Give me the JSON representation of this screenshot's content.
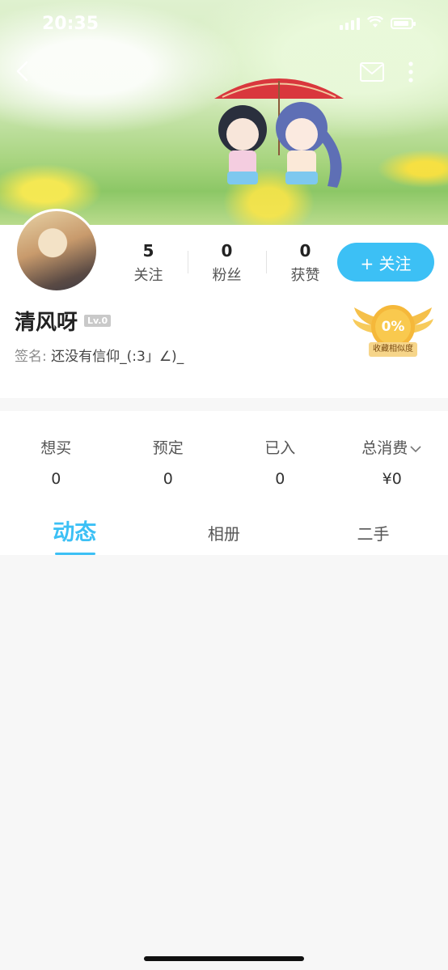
{
  "status_bar": {
    "time": "20:35"
  },
  "profile": {
    "username": "清风呀",
    "level": "Lv.0",
    "signature_label": "签名:",
    "signature_text": "还没有信仰_(:3」∠)_",
    "stats": [
      {
        "value": "5",
        "label": "关注"
      },
      {
        "value": "0",
        "label": "粉丝"
      },
      {
        "value": "0",
        "label": "获赞"
      }
    ],
    "follow_button": "+ 关注",
    "similarity_badge": {
      "percent": "0%",
      "label": "收藏相似度"
    }
  },
  "shopping": [
    {
      "label": "想买",
      "value": "0"
    },
    {
      "label": "预定",
      "value": "0"
    },
    {
      "label": "已入",
      "value": "0"
    },
    {
      "label": "总消费",
      "value": "¥0"
    }
  ],
  "tabs": [
    {
      "label": "动态",
      "active": true
    },
    {
      "label": "相册",
      "active": false
    },
    {
      "label": "二手",
      "active": false
    }
  ],
  "colors": {
    "accent": "#3cc0f5"
  }
}
